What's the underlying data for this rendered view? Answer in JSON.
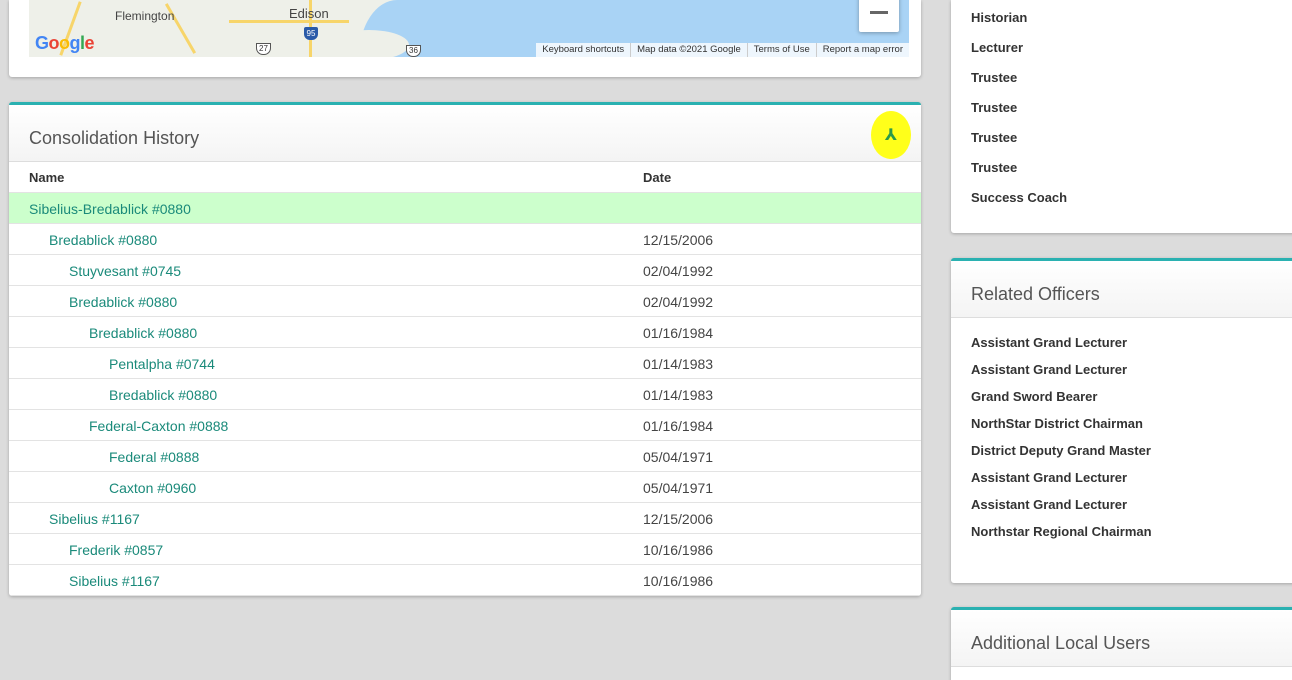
{
  "map": {
    "cities": [
      "Flemington",
      "Edison"
    ],
    "logo": "Google",
    "route_shields": [
      "27",
      "95",
      "36"
    ],
    "attribution": [
      "Keyboard shortcuts",
      "Map data ©2021 Google",
      "Terms of Use",
      "Report a map error"
    ],
    "zoom_out_icon": "minus-icon"
  },
  "consolidation": {
    "title": "Consolidation History",
    "merge_icon": "merge-icon",
    "columns": {
      "name": "Name",
      "date": "Date"
    },
    "rows": [
      {
        "name": "Sibelius-Bredablick #0880",
        "date": "",
        "level": 0,
        "highlight": true
      },
      {
        "name": "Bredablick #0880",
        "date": "12/15/2006",
        "level": 1
      },
      {
        "name": "Stuyvesant #0745",
        "date": "02/04/1992",
        "level": 2
      },
      {
        "name": "Bredablick #0880",
        "date": "02/04/1992",
        "level": 2
      },
      {
        "name": "Bredablick #0880",
        "date": "01/16/1984",
        "level": 3
      },
      {
        "name": "Pentalpha #0744",
        "date": "01/14/1983",
        "level": 4
      },
      {
        "name": "Bredablick #0880",
        "date": "01/14/1983",
        "level": 4
      },
      {
        "name": "Federal-Caxton #0888",
        "date": "01/16/1984",
        "level": 3
      },
      {
        "name": "Federal #0888",
        "date": "05/04/1971",
        "level": 4
      },
      {
        "name": "Caxton #0960",
        "date": "05/04/1971",
        "level": 4
      },
      {
        "name": "Sibelius #1167",
        "date": "12/15/2006",
        "level": 1
      },
      {
        "name": "Frederik #0857",
        "date": "10/16/1986",
        "level": 2
      },
      {
        "name": "Sibelius #1167",
        "date": "10/16/1986",
        "level": 2
      }
    ]
  },
  "officers": [
    "Historian",
    "Lecturer",
    "Trustee",
    "Trustee",
    "Trustee",
    "Trustee",
    "Success Coach"
  ],
  "related_officers": {
    "title": "Related Officers",
    "items": [
      "Assistant Grand Lecturer",
      "Assistant Grand Lecturer",
      "Grand Sword Bearer",
      "NorthStar District Chairman",
      "District Deputy Grand Master",
      "Assistant Grand Lecturer",
      "Assistant Grand Lecturer",
      "Northstar Regional Chairman"
    ]
  },
  "additional_users": {
    "title": "Additional Local Users"
  },
  "colors": {
    "accent": "#2ab1b1",
    "link": "#1a8a7a",
    "highlight_row": "#ccffcc",
    "highlighter": "#ffff1a"
  }
}
